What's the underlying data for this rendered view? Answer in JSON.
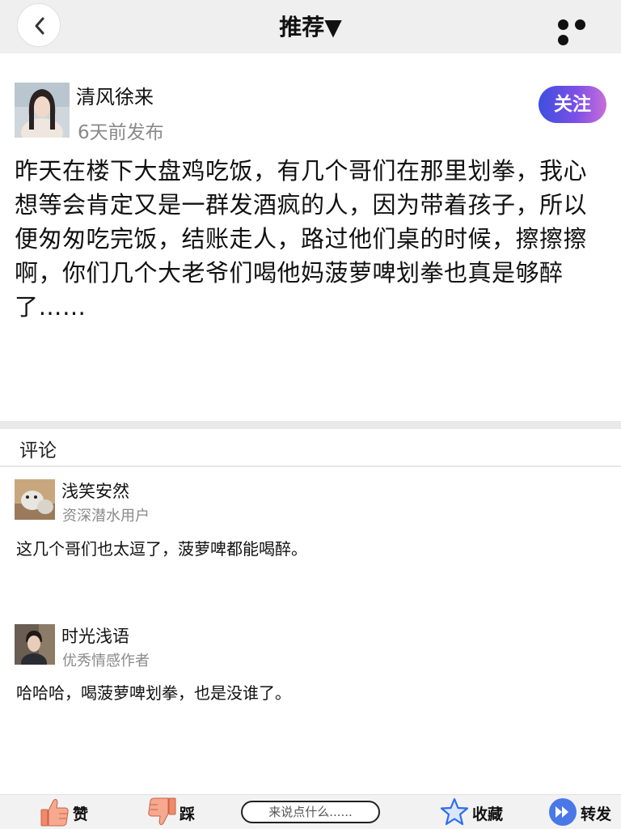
{
  "header": {
    "title": "推荐▼",
    "back_icon": "chevron-left-icon",
    "more_icon": "more-dots-icon"
  },
  "post": {
    "author": {
      "name": "清风徐来",
      "time": "6天前发布",
      "avatar_icon": "user-avatar"
    },
    "follow_label": "关注",
    "content": "昨天在楼下大盘鸡吃饭，有几个哥们在那里划拳，我心想等会肯定又是一群发酒疯的人，因为带着孩子，所以便匆匆吃完饭，结账走人，路过他们桌的时候，擦擦擦啊，你们几个大老爷们喝他妈菠萝啤划拳也真是够醉了……"
  },
  "comments": {
    "title": "评论",
    "items": [
      {
        "name": "浅笑安然",
        "role": "资深潜水用户",
        "text": "这几个哥们也太逗了，菠萝啤都能喝醉。"
      },
      {
        "name": "时光浅语",
        "role": "优秀情感作者",
        "text": "哈哈哈，喝菠萝啤划拳，也是没谁了。"
      }
    ]
  },
  "bottom_bar": {
    "like_label": "赞",
    "dislike_label": "踩",
    "input_placeholder": "来说点什么......",
    "favorite_label": "收藏",
    "share_label": "转发"
  },
  "colors": {
    "follow_gradient_start": "#3d4fe0",
    "follow_gradient_end": "#c86ed8",
    "star_blue": "#2f6df0",
    "share_blue": "#4a78e8",
    "thumb_orange": "#f08a6a"
  }
}
